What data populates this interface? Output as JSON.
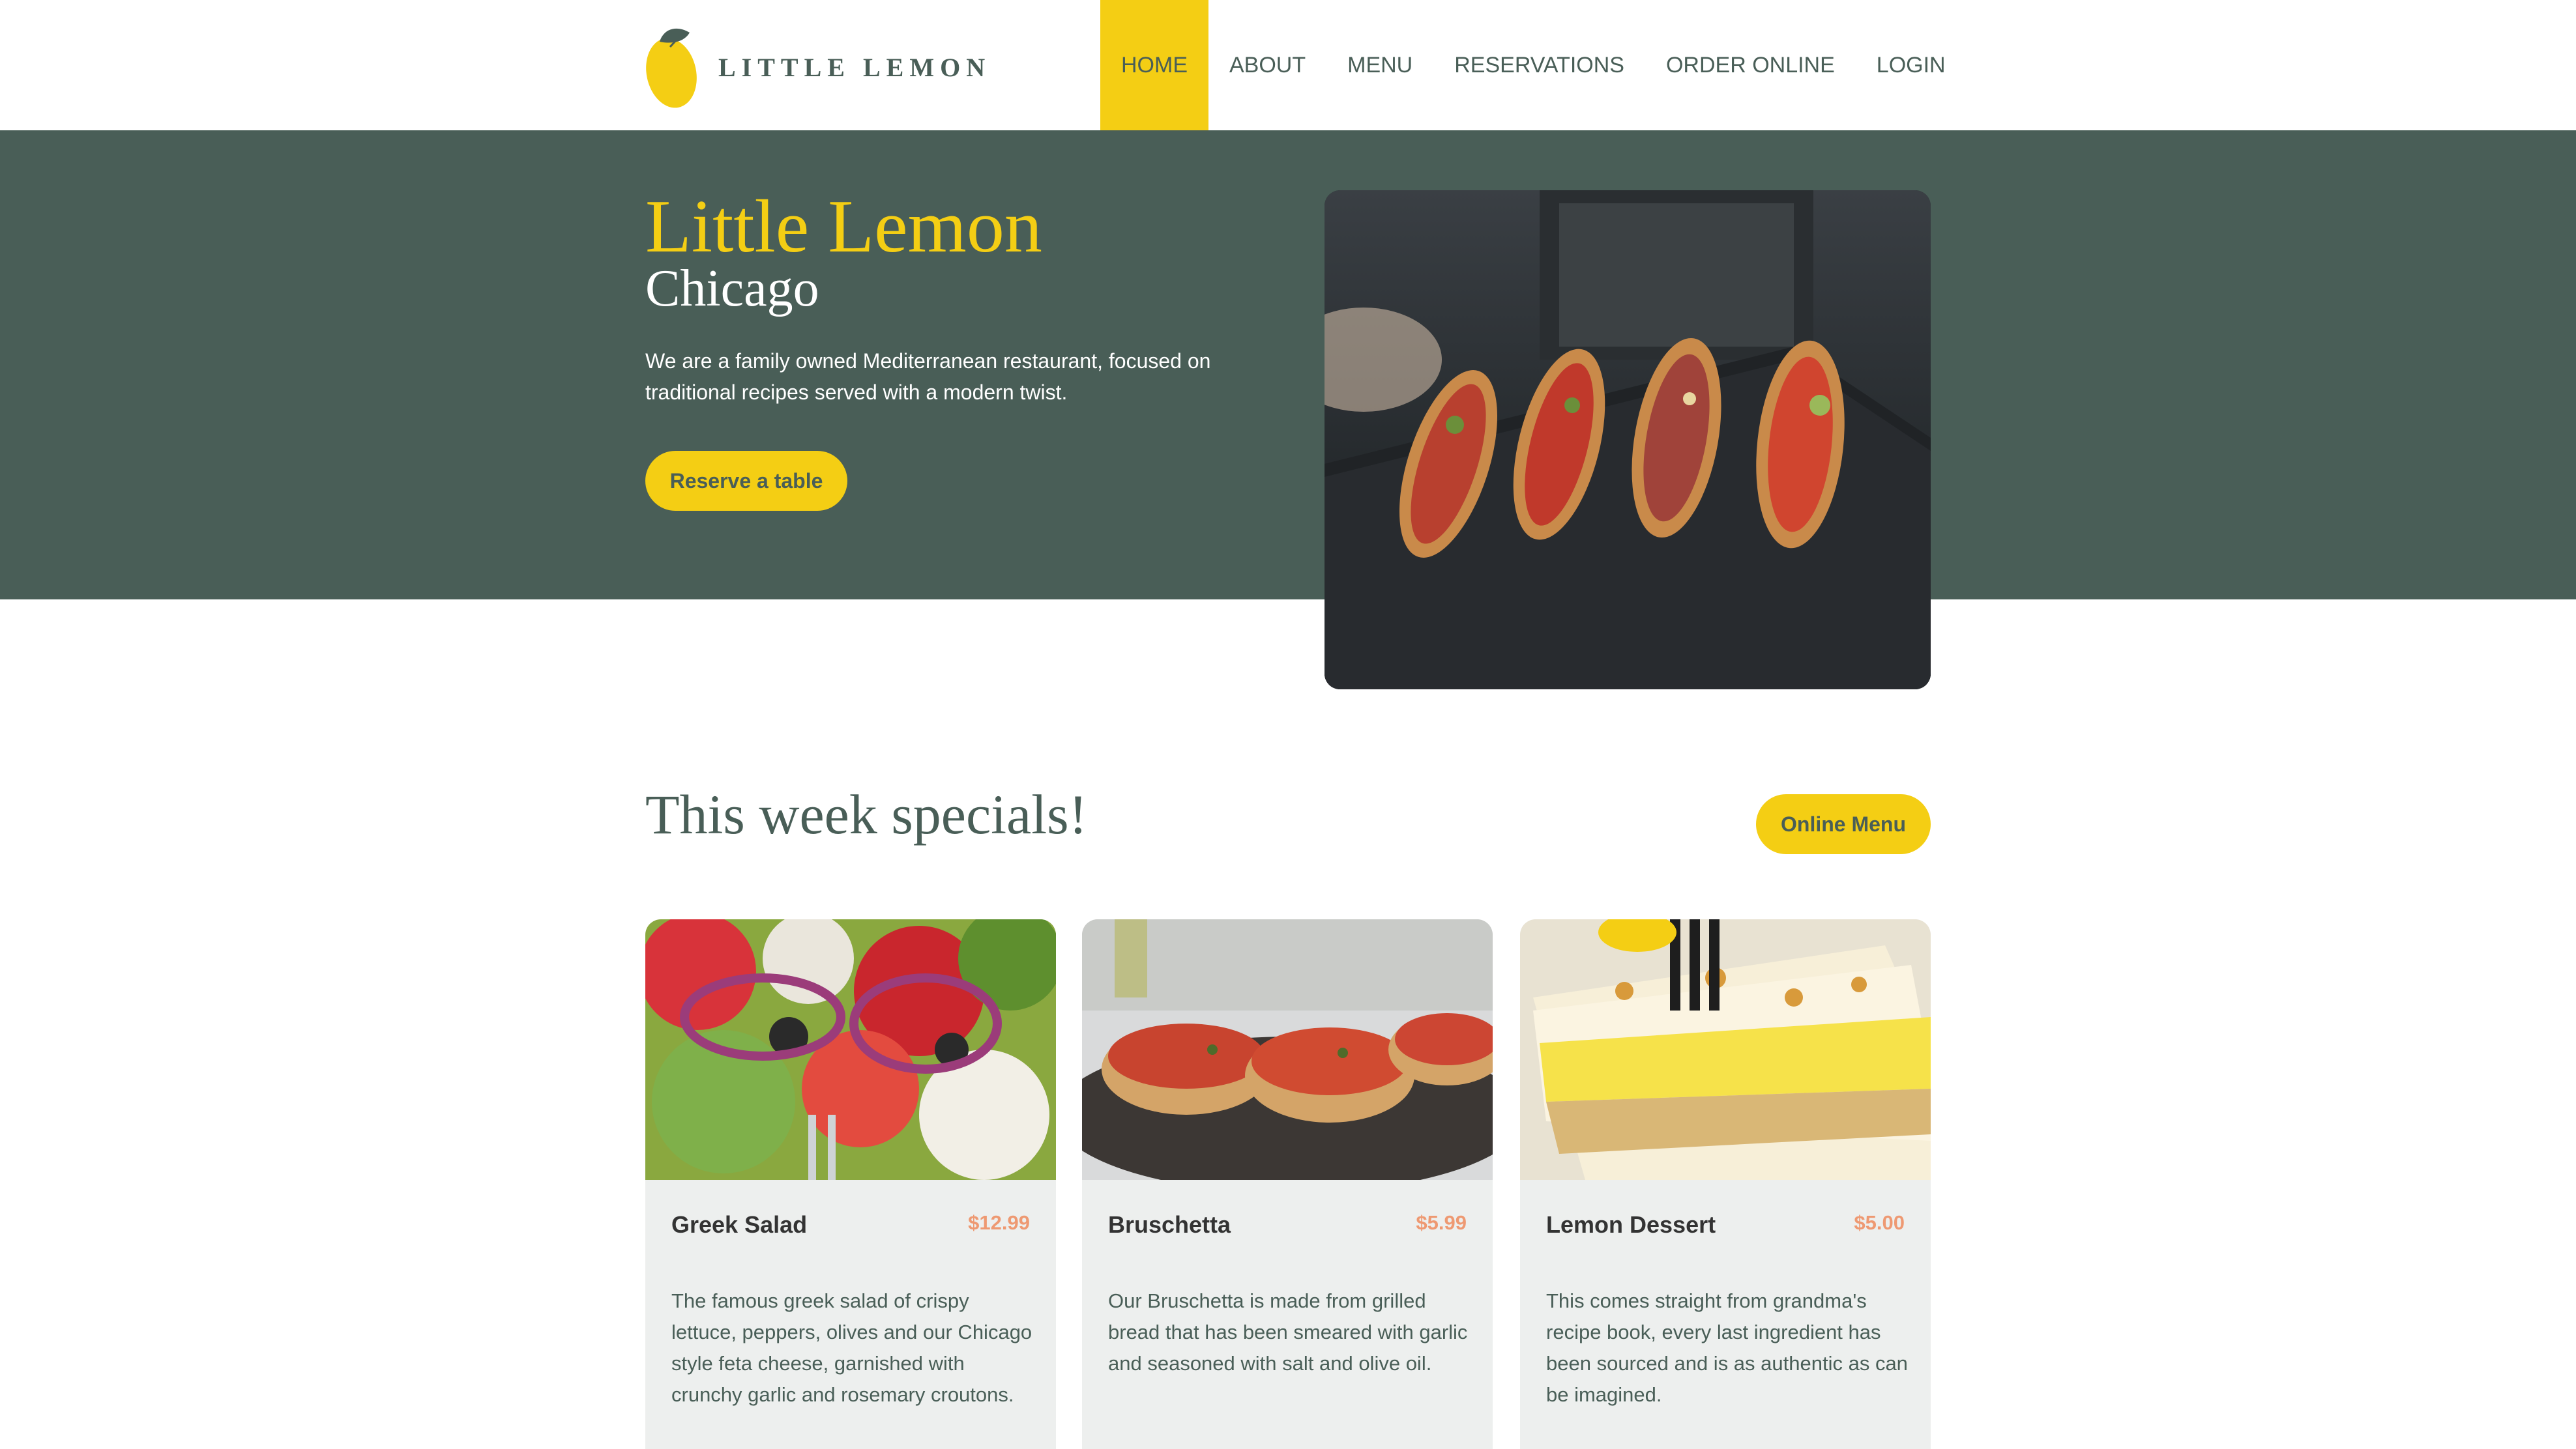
{
  "brand": {
    "name": "LITTLE LEMON",
    "accent": "#f4ce14",
    "primary": "#495e57",
    "highlight": "#ee9972"
  },
  "nav": {
    "items": [
      {
        "label": "HOME",
        "active": true
      },
      {
        "label": "ABOUT"
      },
      {
        "label": "MENU"
      },
      {
        "label": "RESERVATIONS"
      },
      {
        "label": "ORDER ONLINE"
      },
      {
        "label": "LOGIN"
      }
    ]
  },
  "hero": {
    "title": "Little Lemon",
    "subtitle": "Chicago",
    "description": "We are a family owned Mediterranean restaurant, focused on traditional recipes served with a modern twist.",
    "cta_label": "Reserve a table"
  },
  "specials": {
    "title": "This week specials!",
    "menu_button": "Online Menu",
    "items": [
      {
        "name": "Greek Salad",
        "price": "$12.99",
        "description": "The famous greek salad of crispy lettuce, peppers, olives and our Chicago style feta cheese, garnished with crunchy garlic and rosemary croutons."
      },
      {
        "name": "Bruschetta",
        "price": "$5.99",
        "description": "Our Bruschetta is made from grilled bread that has been smeared with garlic and seasoned with salt and olive oil."
      },
      {
        "name": "Lemon Dessert",
        "price": "$5.00",
        "description": "This comes straight from grandma's recipe book, every last ingredient has been sourced and is as authentic as can be imagined."
      }
    ]
  }
}
